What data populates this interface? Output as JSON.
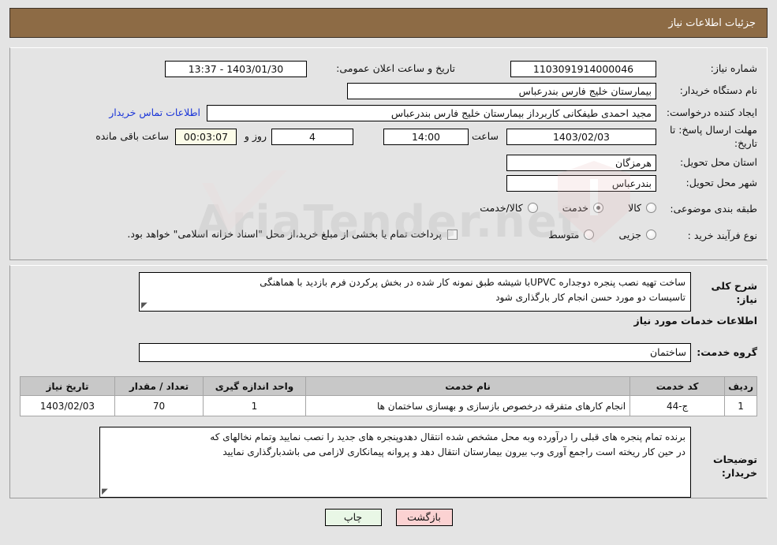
{
  "header": {
    "title": "جزئیات اطلاعات نیاز"
  },
  "watermark": {
    "text": "AriaTender.net"
  },
  "top_form": {
    "need_number_label": "شماره نیاز:",
    "need_number_value": "1103091914000046",
    "announce_label": "تاریخ و ساعت اعلان عمومی:",
    "announce_value": "1403/01/30 - 13:37",
    "buyer_org_label": "نام دستگاه خریدار:",
    "buyer_org_value": "بیمارستان خلیج فارس بندرعباس",
    "requester_label": "ایجاد کننده درخواست:",
    "requester_value": "مجید احمدی طیفکانی کاربرداز بیمارستان خلیج فارس بندرعباس",
    "contact_link": "اطلاعات تماس خریدار",
    "deadline_label": "مهلت ارسال پاسخ: تا تاریخ:",
    "deadline_date": "1403/02/03",
    "hour_label": "ساعت",
    "hour_value": "14:00",
    "days_value": "4",
    "days_label": "روز و",
    "countdown_value": "00:03:07",
    "countdown_label": "ساعت باقی مانده",
    "province_label": "استان محل تحویل:",
    "province_value": "هرمزگان",
    "city_label": "شهر محل تحویل:",
    "city_value": "بندرعباس",
    "category_label": "طبقه بندی موضوعی:",
    "category_options": [
      {
        "label": "کالا",
        "selected": false
      },
      {
        "label": "خدمت",
        "selected": true
      },
      {
        "label": "کالا/خدمت",
        "selected": false
      }
    ],
    "process_label": "نوع فرآیند خرید :",
    "process_options": [
      {
        "label": "جزیی",
        "selected": false
      },
      {
        "label": "متوسط",
        "selected": false
      }
    ],
    "treasury_checkbox_label": "پرداخت تمام یا بخشی از مبلغ خرید،از محل \"اسناد خزانه اسلامی\" خواهد بود.",
    "treasury_checked": false
  },
  "mid_form": {
    "description_label": "شرح کلی نیاز:",
    "description_line1": "ساخت تهیه نصب پنجره دوجداره UPVCبا شیشه طبق نمونه کار شده در بخش پرکردن فرم بازدید با هماهنگی",
    "description_line2": "تاسیسات دو مورد حسن انجام کار بارگذاری شود",
    "services_heading": "اطلاعات خدمات مورد نیاز",
    "service_group_label": "گروه خدمت:",
    "service_group_value": "ساختمان",
    "buyer_notes_label": "توضیحات خریدار:",
    "buyer_notes_line1": "برنده تمام پنجره های قبلی را درآورده وبه محل مشخص شده انتقال دهدوپنجره های جدید را نصب نمایید وتمام نخالهای که",
    "buyer_notes_line2": "در حین کار ریخته است راجمع آوری وب بیرون بیمارستان انتقال دهد و پروانه پیمانکاری لازامی می باشدبارگذاری نمایید"
  },
  "table": {
    "headers": [
      "ردیف",
      "کد خدمت",
      "نام خدمت",
      "واحد اندازه گیری",
      "تعداد / مقدار",
      "تاریخ نیاز"
    ],
    "rows": [
      {
        "row_no": "1",
        "service_code": "ج-44",
        "service_name": "انجام کارهای متفرقه درخصوص بازسازی و بهسازی ساختمان ها",
        "unit": "1",
        "quantity": "70",
        "need_date": "1403/02/03"
      }
    ]
  },
  "footer": {
    "print_label": "چاپ",
    "back_label": "بازگشت"
  },
  "colors": {
    "header_bg": "#8d6b45",
    "page_bg": "#e4e4e4",
    "link": "#1a35d8",
    "countdown_bg": "#fbfbe8",
    "print_btn_bg": "#e9f7e6",
    "back_btn_bg": "#fbd2d2",
    "table_header_bg": "#c8c8c8"
  }
}
